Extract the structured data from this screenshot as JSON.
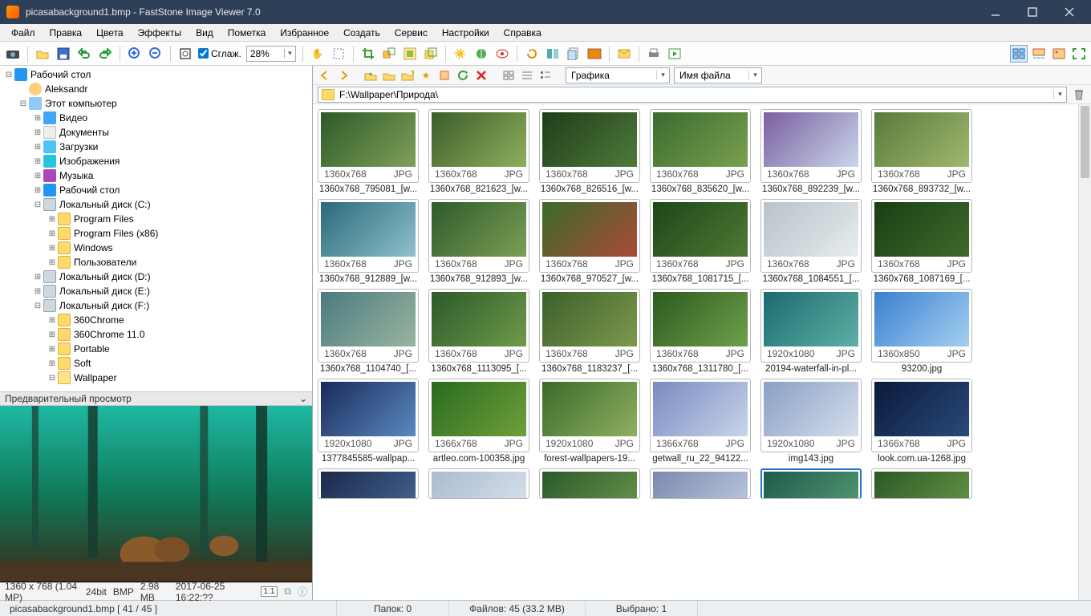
{
  "titlebar": {
    "text": "picasabackground1.bmp  -  FastStone Image Viewer 7.0"
  },
  "menu": [
    "Файл",
    "Правка",
    "Цвета",
    "Эффекты",
    "Вид",
    "Пометка",
    "Избранное",
    "Создать",
    "Сервис",
    "Настройки",
    "Справка"
  ],
  "toolbar": {
    "smooth_label": "Сглаж.",
    "zoom_value": "28%"
  },
  "right_view_tools": [
    "thumbs-view",
    "details-view",
    "single-view",
    "fullscreen-view"
  ],
  "tree": [
    {
      "ind": 0,
      "tw": "-",
      "ico": "ico-monitor",
      "label": "Рабочий стол"
    },
    {
      "ind": 1,
      "tw": "",
      "ico": "ico-user",
      "label": "Aleksandr"
    },
    {
      "ind": 1,
      "tw": "-",
      "ico": "ico-pc",
      "label": "Этот компьютер"
    },
    {
      "ind": 2,
      "tw": "+",
      "ico": "ico-video",
      "label": "Видео"
    },
    {
      "ind": 2,
      "tw": "+",
      "ico": "ico-doc",
      "label": "Документы"
    },
    {
      "ind": 2,
      "tw": "+",
      "ico": "ico-down",
      "label": "Загрузки"
    },
    {
      "ind": 2,
      "tw": "+",
      "ico": "ico-img",
      "label": "Изображения"
    },
    {
      "ind": 2,
      "tw": "+",
      "ico": "ico-music",
      "label": "Музыка"
    },
    {
      "ind": 2,
      "tw": "+",
      "ico": "ico-monitor",
      "label": "Рабочий стол"
    },
    {
      "ind": 2,
      "tw": "-",
      "ico": "ico-drive",
      "label": "Локальный диск (C:)"
    },
    {
      "ind": 3,
      "tw": "+",
      "ico": "ico-folder",
      "label": "Program Files"
    },
    {
      "ind": 3,
      "tw": "+",
      "ico": "ico-folder",
      "label": "Program Files (x86)"
    },
    {
      "ind": 3,
      "tw": "+",
      "ico": "ico-folder",
      "label": "Windows"
    },
    {
      "ind": 3,
      "tw": "+",
      "ico": "ico-folder",
      "label": "Пользователи"
    },
    {
      "ind": 2,
      "tw": "+",
      "ico": "ico-drive",
      "label": "Локальный диск (D:)"
    },
    {
      "ind": 2,
      "tw": "+",
      "ico": "ico-drive",
      "label": "Локальный диск (E:)"
    },
    {
      "ind": 2,
      "tw": "-",
      "ico": "ico-drive",
      "label": "Локальный диск (F:)"
    },
    {
      "ind": 3,
      "tw": "+",
      "ico": "ico-folder",
      "label": "360Chrome"
    },
    {
      "ind": 3,
      "tw": "+",
      "ico": "ico-folder",
      "label": "360Chrome 11.0"
    },
    {
      "ind": 3,
      "tw": "+",
      "ico": "ico-folder",
      "label": "Portable"
    },
    {
      "ind": 3,
      "tw": "+",
      "ico": "ico-folder",
      "label": "Soft"
    },
    {
      "ind": 3,
      "tw": "-",
      "ico": "ico-folder-open",
      "label": "Wallpaper"
    }
  ],
  "preview": {
    "header": "Предварительный просмотр",
    "info_res": "1360 x 768 (1.04 MP)",
    "info_depth": "24bit",
    "info_fmt": "BMP",
    "info_size": "2.98 MB",
    "info_date": "2017-06-25 16:22:??",
    "badge": "1:1"
  },
  "navrow": {
    "filter_label": "Графика",
    "sort_label": "Имя файла"
  },
  "path": "F:\\Wallpaper\\Природа\\",
  "thumbs": [
    [
      {
        "dims": "1360x768",
        "fmt": "JPG",
        "name": "1360x768_795081_[w...",
        "grad": "linear-gradient(135deg,#2d5a27,#7fa05a)"
      },
      {
        "dims": "1360x768",
        "fmt": "JPG",
        "name": "1360x768_821623_[w...",
        "grad": "linear-gradient(135deg,#3a5f2a,#8fae5c)"
      },
      {
        "dims": "1360x768",
        "fmt": "JPG",
        "name": "1360x768_826516_[w...",
        "grad": "linear-gradient(135deg,#1e3d1a,#4f7a3a)"
      },
      {
        "dims": "1360x768",
        "fmt": "JPG",
        "name": "1360x768_835620_[w...",
        "grad": "linear-gradient(135deg,#3a6b2e,#7aa04f)"
      },
      {
        "dims": "1360x768",
        "fmt": "JPG",
        "name": "1360x768_892239_[w...",
        "grad": "linear-gradient(135deg,#7a5fa0,#c9d6ea)"
      },
      {
        "dims": "1360x768",
        "fmt": "JPG",
        "name": "1360x768_893732_[w...",
        "grad": "linear-gradient(135deg,#5a7a3a,#a0b86f)"
      }
    ],
    [
      {
        "dims": "1360x768",
        "fmt": "JPG",
        "name": "1360x768_912889_[w...",
        "grad": "linear-gradient(135deg,#2a6a7a,#8fc1cc)"
      },
      {
        "dims": "1360x768",
        "fmt": "JPG",
        "name": "1360x768_912893_[w...",
        "grad": "linear-gradient(135deg,#2f5a2a,#7a9f55)"
      },
      {
        "dims": "1360x768",
        "fmt": "JPG",
        "name": "1360x768_970527_[w...",
        "grad": "linear-gradient(135deg,#3a6a2a,#aa4a3a)"
      },
      {
        "dims": "1360x768",
        "fmt": "JPG",
        "name": "1360x768_1081715_[...",
        "grad": "linear-gradient(135deg,#1e4518,#4f7a35)"
      },
      {
        "dims": "1360x768",
        "fmt": "JPG",
        "name": "1360x768_1084551_[...",
        "grad": "linear-gradient(135deg,#b8c2c8,#e7ecef)"
      },
      {
        "dims": "1360x768",
        "fmt": "JPG",
        "name": "1360x768_1087169_[...",
        "grad": "linear-gradient(135deg,#1a3d15,#3f6a2a)"
      }
    ],
    [
      {
        "dims": "1360x768",
        "fmt": "JPG",
        "name": "1360x768_1104740_[...",
        "grad": "linear-gradient(135deg,#4a7a7f,#9ab59f)"
      },
      {
        "dims": "1360x768",
        "fmt": "JPG",
        "name": "1360x768_1113095_[...",
        "grad": "linear-gradient(135deg,#2a5a2a,#6f9a4a)"
      },
      {
        "dims": "1360x768",
        "fmt": "JPG",
        "name": "1360x768_1183237_[...",
        "grad": "linear-gradient(135deg,#3a5f2a,#7f9a4f)"
      },
      {
        "dims": "1360x768",
        "fmt": "JPG",
        "name": "1360x768_1311780_[...",
        "grad": "linear-gradient(135deg,#2a5a1f,#6fa04a)"
      },
      {
        "dims": "1920x1080",
        "fmt": "JPG",
        "name": "20194-waterfall-in-pl...",
        "grad": "linear-gradient(135deg,#1a6a6f,#5fb0a5)"
      },
      {
        "dims": "1360x850",
        "fmt": "JPG",
        "name": "93200.jpg",
        "grad": "linear-gradient(135deg,#3a7fd0,#a5d0f0)"
      }
    ],
    [
      {
        "dims": "1920x1080",
        "fmt": "JPG",
        "name": "1377845585-wallpap...",
        "grad": "linear-gradient(135deg,#1a2a5a,#5a8ac0)"
      },
      {
        "dims": "1366x768",
        "fmt": "JPG",
        "name": "artleo.com-100358.jpg",
        "grad": "linear-gradient(135deg,#2a6a1f,#6fa03a)"
      },
      {
        "dims": "1920x1080",
        "fmt": "JPG",
        "name": "forest-wallpapers-19...",
        "grad": "linear-gradient(135deg,#3a6a2a,#8fb05f)"
      },
      {
        "dims": "1366x768",
        "fmt": "JPG",
        "name": "getwall_ru_22_94122...",
        "grad": "linear-gradient(135deg,#7a8ac0,#c8d5ea)"
      },
      {
        "dims": "1920x1080",
        "fmt": "JPG",
        "name": "img143.jpg",
        "grad": "linear-gradient(135deg,#8a9fc5,#d5dfec)"
      },
      {
        "dims": "1366x768",
        "fmt": "JPG",
        "name": "look.com.ua-1268.jpg",
        "grad": "linear-gradient(135deg,#0a1a3a,#2a4a7a)"
      }
    ]
  ],
  "partial_row_grads": [
    "linear-gradient(135deg,#1a2a4a,#4a6a9a)",
    "linear-gradient(135deg,#aabbd0,#dde5ef)",
    "linear-gradient(135deg,#2a5a2a,#6f9a4f)",
    "linear-gradient(135deg,#7a8aaf,#c5d0e2)",
    "linear-gradient(135deg,#1f5a4a,#5aa07a)",
    "linear-gradient(135deg,#2a5a25,#6a9a4a)"
  ],
  "selected_thumb": {
    "row": 4,
    "col": 4
  },
  "status": {
    "file_pos": "picasabackground1.bmp  [ 41 / 45 ]",
    "folders": "Папок: 0",
    "files": "Файлов: 45 (33.2 MB)",
    "selected": "Выбрано: 1"
  }
}
